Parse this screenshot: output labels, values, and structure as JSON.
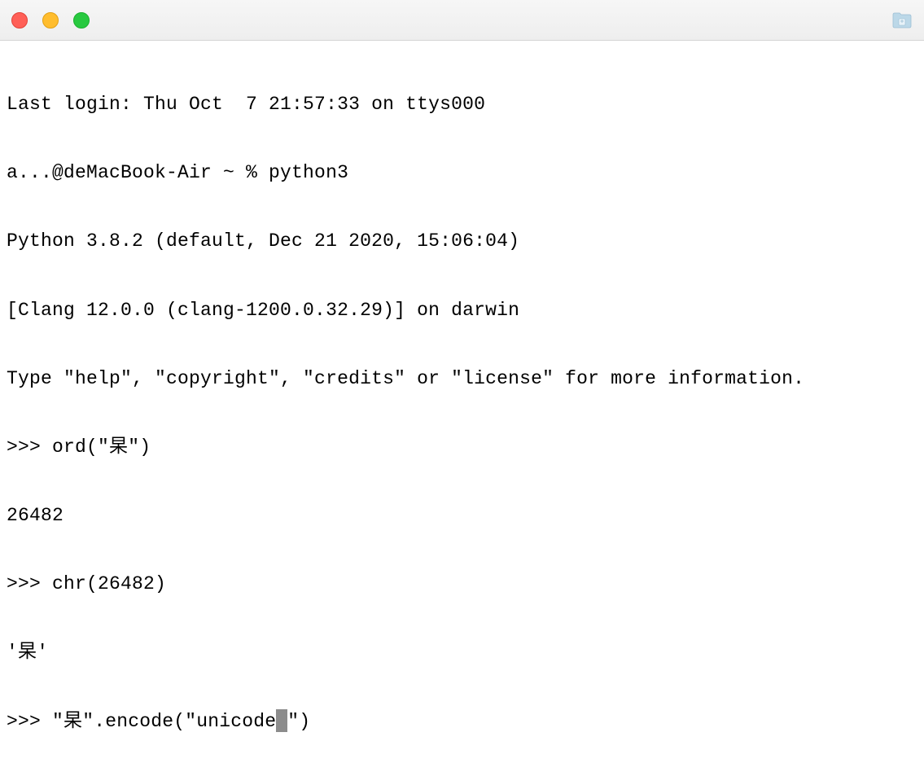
{
  "titlebar": {
    "colors": {
      "close": "#ff5f57",
      "minimize": "#ffbd2e",
      "maximize": "#28c940"
    }
  },
  "terminal": {
    "lines": {
      "last_login": "Last login: Thu Oct  7 21:57:33 on ttys000",
      "shell_prompt": "a...@deMacBook-Air ~ % python3",
      "python_version": "Python 3.8.2 (default, Dec 21 2020, 15:06:04)",
      "compiler": "[Clang 12.0.0 (clang-1200.0.32.29)] on darwin",
      "help_hint": "Type \"help\", \"copyright\", \"credits\" or \"license\" for more information.",
      "prompt1": ">>> ord(\"杲\")",
      "result1": "26482",
      "prompt2": ">>> chr(26482)",
      "result2": "'杲'",
      "prompt3_pre": ">>> \"杲\".encode(\"unicode",
      "prompt3_post": "\")"
    }
  }
}
